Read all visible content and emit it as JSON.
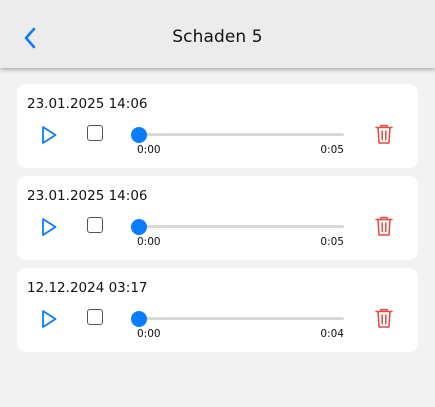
{
  "header": {
    "title": "Schaden 5",
    "back_icon": "chevron-left-icon"
  },
  "colors": {
    "accent": "#0a7cff",
    "danger": "#e5483d",
    "background": "#f2f2f2",
    "card": "#ffffff"
  },
  "recordings": [
    {
      "date": "23.01.2025 14:06",
      "current_time": "0:00",
      "duration": "0:05",
      "progress": 0
    },
    {
      "date": "23.01.2025 14:06",
      "current_time": "0:00",
      "duration": "0:05",
      "progress": 0
    },
    {
      "date": "12.12.2024 03:17",
      "current_time": "0:00",
      "duration": "0:04",
      "progress": 0
    }
  ],
  "icons": {
    "play": "play-icon",
    "checkbox": "checkbox-icon",
    "delete": "trash-icon"
  }
}
